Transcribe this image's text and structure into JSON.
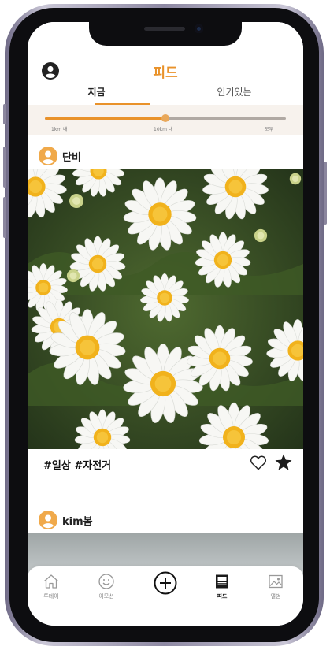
{
  "header": {
    "title": "피드"
  },
  "tabs": [
    {
      "label": "지금",
      "active": true
    },
    {
      "label": "인기있는",
      "active": false
    }
  ],
  "distance_filter": {
    "labels": [
      "1km 내",
      "10km 내",
      "모두"
    ],
    "value_fraction": 0.5
  },
  "posts": [
    {
      "username": "단비",
      "caption": "#일상 #자전거",
      "liked": false,
      "starred": true
    },
    {
      "username": "kim봄"
    }
  ],
  "bottom_nav": [
    {
      "label": "투데이",
      "icon": "home-icon"
    },
    {
      "label": "이모션",
      "icon": "smiley-icon"
    },
    {
      "label": "",
      "icon": "plus-circle-icon"
    },
    {
      "label": "피드",
      "icon": "feed-icon",
      "active": true
    },
    {
      "label": "앨범",
      "icon": "album-icon"
    }
  ],
  "colors": {
    "accent": "#e9922a",
    "avatar": "#f0a94a",
    "track": "#b0a9a3"
  }
}
